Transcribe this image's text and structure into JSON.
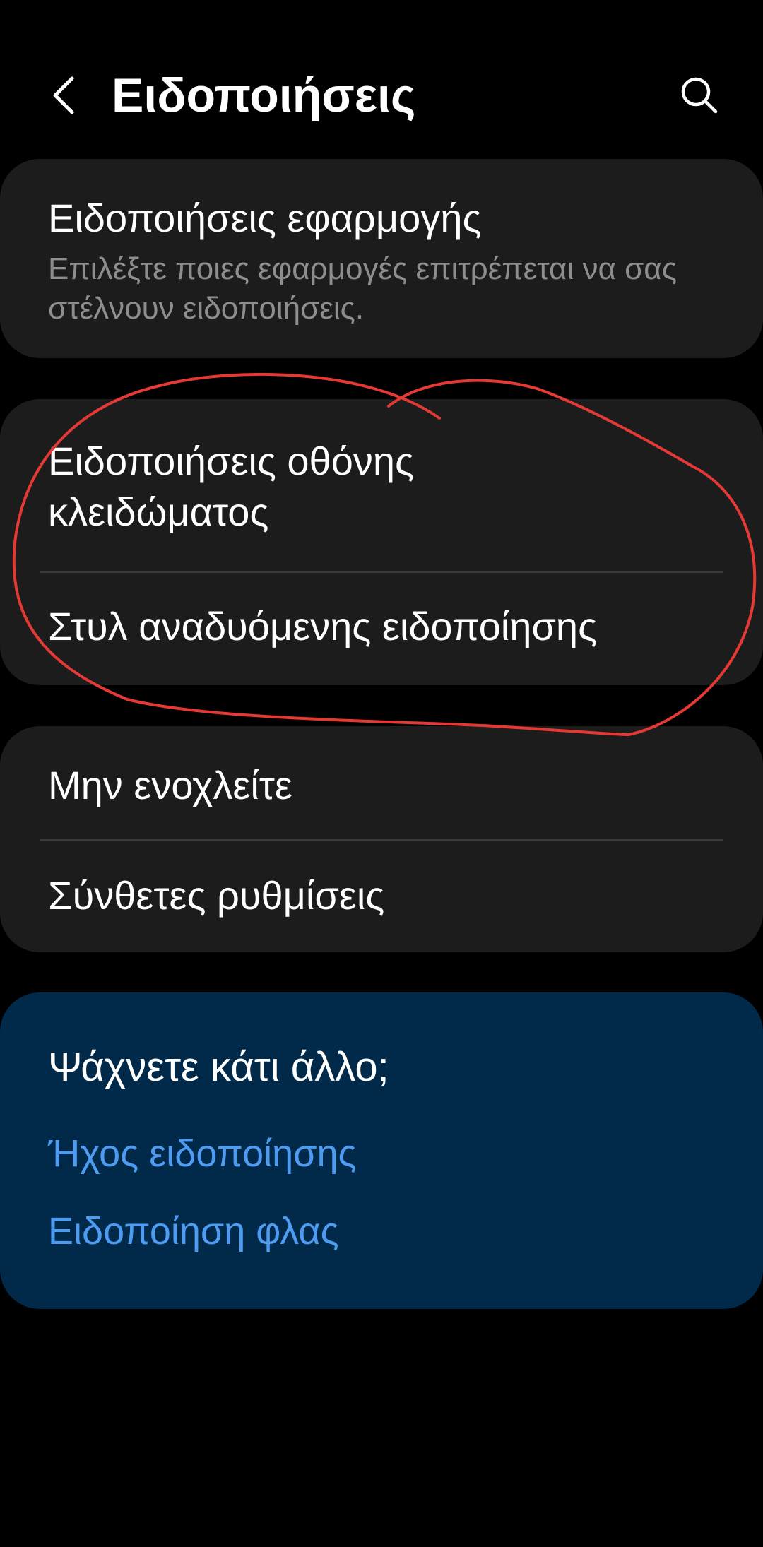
{
  "header": {
    "title": "Ειδοποιήσεις",
    "back_icon": "chevron-left-icon",
    "search_icon": "search-icon"
  },
  "app_notifications": {
    "title": "Ειδοποιήσεις εφαρμογής",
    "subtitle": "Επιλέξτε ποιες εφαρμογές επιτρέπεται να σας στέλνουν ειδοποιήσεις."
  },
  "lock_screen": {
    "title_line1": "Ειδοποιήσεις οθόνης",
    "title_line2": "κλειδώματος"
  },
  "popup_style": {
    "title": "Στυλ αναδυόμενης ειδοποίησης"
  },
  "do_not_disturb": {
    "title": "Μην ενοχλείτε"
  },
  "advanced": {
    "title": "Σύνθετες ρυθμίσεις"
  },
  "suggestions": {
    "title": "Ψάχνετε κάτι άλλο;",
    "links": [
      "Ήχος ειδοποίησης",
      "Ειδοποίηση φλας"
    ]
  },
  "colors": {
    "background": "#000000",
    "card": "#1c1c1c",
    "suggestion_card": "#012a4a",
    "link": "#4d9cf2",
    "annotation_stroke": "#e53935"
  }
}
